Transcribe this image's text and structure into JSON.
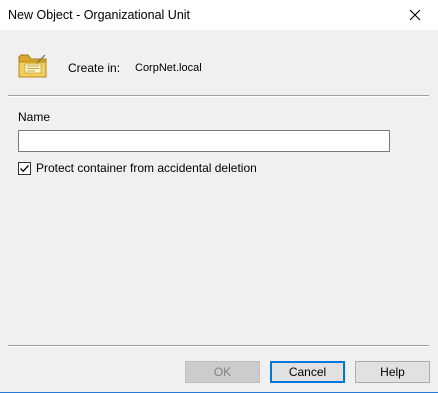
{
  "window": {
    "title": "New Object - Organizational Unit",
    "close_icon": "close-x-icon"
  },
  "header": {
    "icon": "organizational-unit-folder-icon",
    "create_in_label": "Create in:",
    "create_in_value": "CorpNet.local"
  },
  "form": {
    "name_label": "Name",
    "name_value": "",
    "protect_label": "Protect container from accidental deletion",
    "protect_checked": true
  },
  "buttons": {
    "ok_label": "OK",
    "ok_enabled": false,
    "cancel_label": "Cancel",
    "help_label": "Help"
  },
  "colors": {
    "window_bg": "#f0f0f0",
    "focus_border": "#0078d7",
    "disabled_text": "#838383"
  }
}
